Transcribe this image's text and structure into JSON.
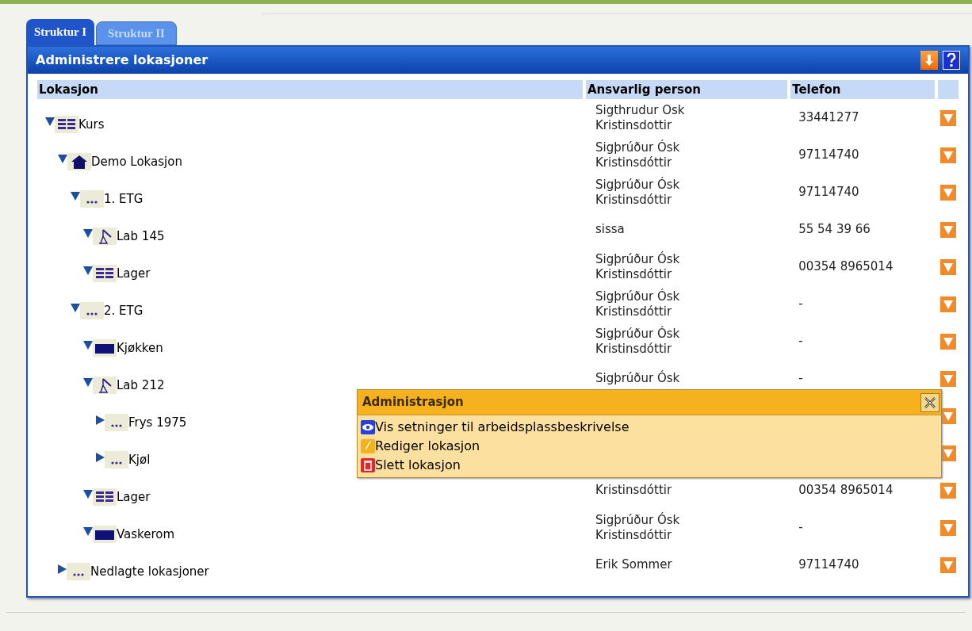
{
  "tabs": [
    {
      "label": "Struktur I",
      "selected": true
    },
    {
      "label": "Struktur II",
      "selected": false
    }
  ],
  "panel": {
    "title": "Administrere lokasjoner"
  },
  "table": {
    "columns": [
      "Lokasjon",
      "Ansvarlig person",
      "Telefon"
    ],
    "rows": [
      {
        "name": "Kurs",
        "kind": "grid",
        "expanded": true,
        "person": "Sigthrudur Osk Kristinsdottir",
        "phone": "33441277",
        "children": [
          {
            "name": "Demo Lokasjon",
            "kind": "house",
            "expanded": true,
            "person": "Sigþrúður Ósk Kristinsdóttir",
            "phone": "97114740",
            "children": [
              {
                "name": "1. ETG",
                "kind": "dots",
                "expanded": true,
                "person": "Sigþrúður Ósk Kristinsdóttir",
                "phone": "97114740",
                "children": [
                  {
                    "name": "Lab 145",
                    "kind": "lab",
                    "expanded": true,
                    "person": "sissa",
                    "phone": "55 54 39 66"
                  },
                  {
                    "name": "Lager",
                    "kind": "grid",
                    "expanded": true,
                    "person": "Sigþrúður Ósk Kristinsdóttir",
                    "phone": "00354 8965014"
                  }
                ]
              },
              {
                "name": "2. ETG",
                "kind": "dots",
                "expanded": true,
                "person": "Sigþrúður Ósk Kristinsdóttir",
                "phone": "-",
                "children": [
                  {
                    "name": "Kjøkken",
                    "kind": "block",
                    "expanded": true,
                    "person": "Sigþrúður Ósk Kristinsdóttir",
                    "phone": "-"
                  },
                  {
                    "name": "Lab 212",
                    "kind": "lab",
                    "expanded": true,
                    "person": "Sigþrúður Ósk",
                    "phone": "-",
                    "children": [
                      {
                        "name": "Frys 1975",
                        "kind": "dots",
                        "expanded": false
                      },
                      {
                        "name": "Kjøl",
                        "kind": "dots",
                        "expanded": false
                      }
                    ]
                  },
                  {
                    "name": "Lager",
                    "kind": "grid",
                    "expanded": true,
                    "person": "Kristinsdóttir",
                    "phone": "00354 8965014"
                  },
                  {
                    "name": "Vaskerom",
                    "kind": "block",
                    "expanded": true,
                    "person": "Sigþrúður Ósk Kristinsdóttir",
                    "phone": "-"
                  }
                ]
              }
            ]
          },
          {
            "name": "Nedlagte lokasjoner",
            "kind": "dots",
            "expanded": false,
            "person": "Erik Sommer",
            "phone": "97114740"
          }
        ]
      }
    ]
  },
  "popup": {
    "title": "Administrasjon",
    "items": [
      {
        "label": "Vis setninger til arbeidsplassbeskrivelse",
        "kind": "view"
      },
      {
        "label": "Rediger lokasjon",
        "kind": "edit"
      },
      {
        "label": "Slett lokasjon",
        "kind": "delete"
      }
    ]
  }
}
